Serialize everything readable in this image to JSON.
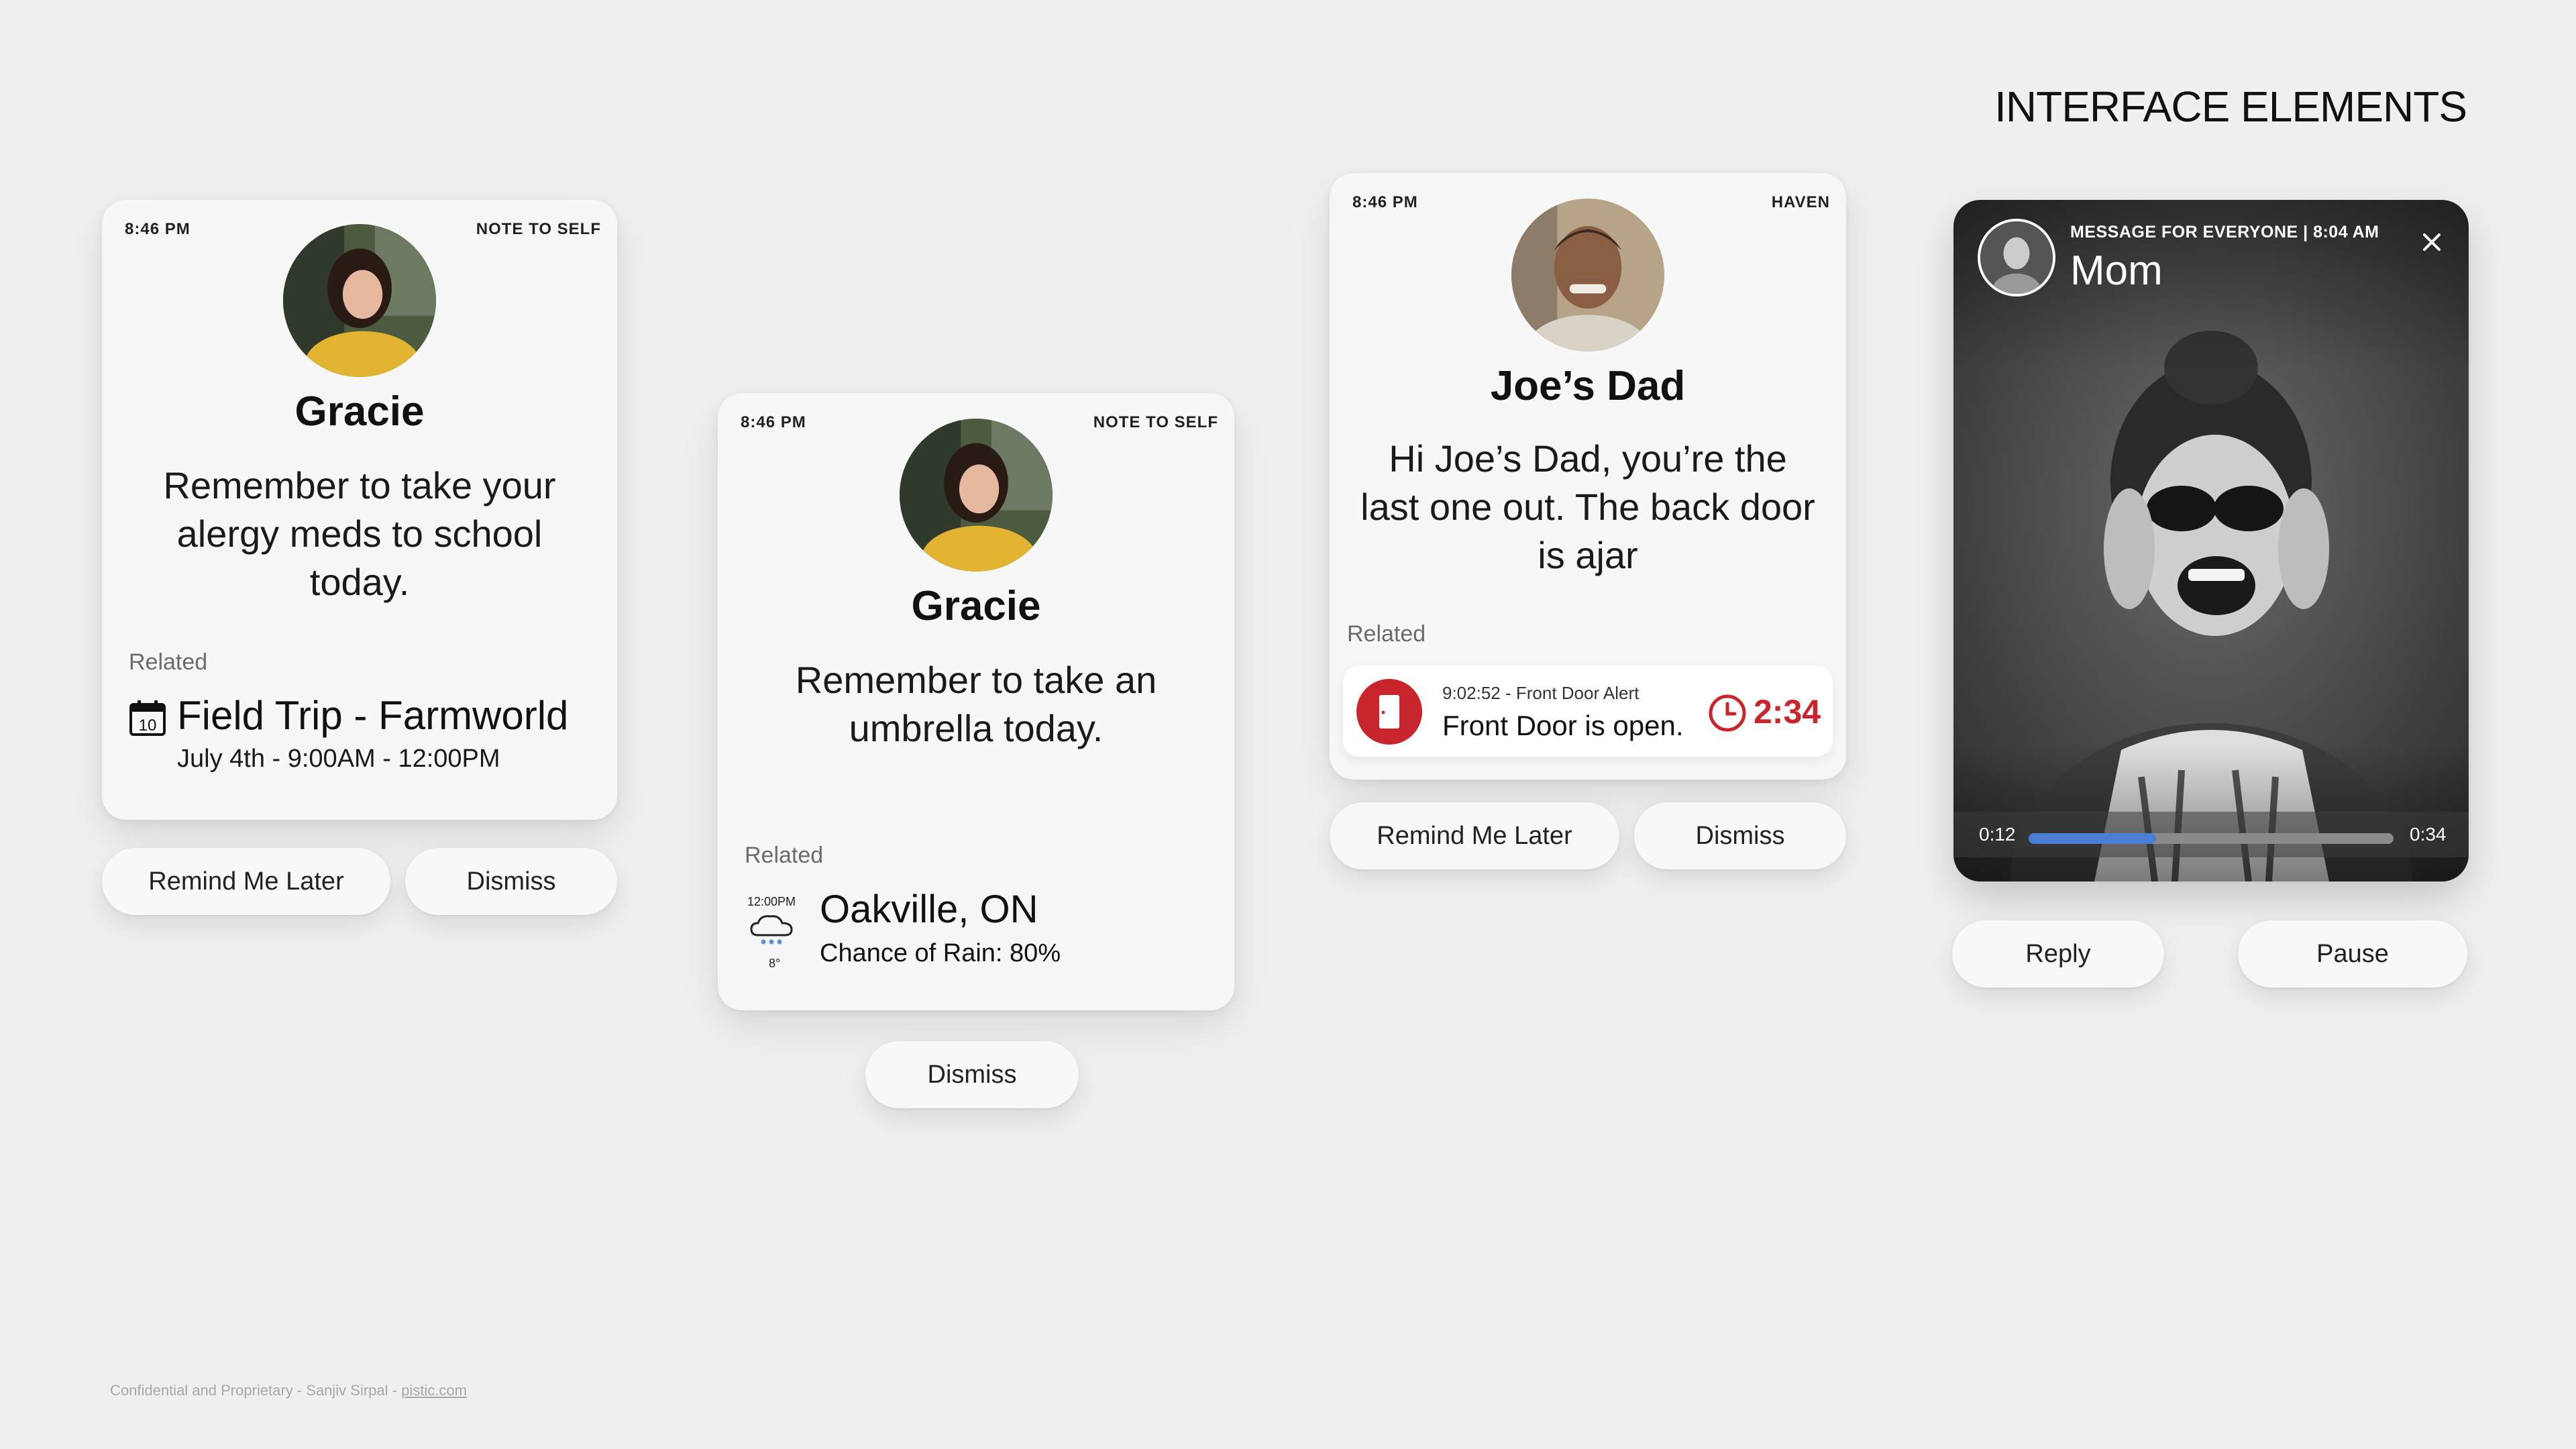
{
  "page": {
    "title": "INTERFACE ELEMENTS"
  },
  "card1": {
    "time": "8:46 PM",
    "label": "NOTE TO SELF",
    "name": "Gracie",
    "message": [
      "Remember to take your",
      "alergy meds to school",
      "today."
    ],
    "related_label": "Related",
    "event": {
      "title": "Field Trip - Farmworld",
      "time": "July 4th - 9:00AM - 12:00PM",
      "calendar_day": "10"
    },
    "buttons": {
      "remind": "Remind Me Later",
      "dismiss": "Dismiss"
    }
  },
  "card2": {
    "time": "8:46 PM",
    "label": "NOTE TO SELF",
    "name": "Gracie",
    "message": [
      "Remember to take an",
      "umbrella today."
    ],
    "related_label": "Related",
    "weather": {
      "time": "12:00PM",
      "temp": "8°",
      "city": "Oakville, ON",
      "desc": "Chance of Rain: 80%"
    },
    "buttons": {
      "dismiss": "Dismiss"
    }
  },
  "card3": {
    "time": "8:46 PM",
    "label": "HAVEN",
    "name": "Joe’s Dad",
    "message": [
      "Hi Joe’s Dad, you’re the",
      "last one out. The back door",
      "is ajar"
    ],
    "related_label": "Related",
    "alert": {
      "subtitle": "9:02:52 - Front Door Alert",
      "title": "Front Door is open.",
      "countdown": "2:34"
    },
    "buttons": {
      "remind": "Remind Me Later",
      "dismiss": "Dismiss"
    },
    "colors": {
      "alert_red": "#c8262c"
    }
  },
  "card4": {
    "header": "MESSAGE FOR EVERYONE | 8:04 AM",
    "sender": "Mom",
    "progress": {
      "current": "0:12",
      "total": "0:34",
      "fraction": 0.35
    },
    "buttons": {
      "reply": "Reply",
      "pause": "Pause"
    },
    "colors": {
      "progress": "#4a7fd6"
    }
  },
  "footer": {
    "text": "Confidential and Proprietary - Sanjiv Sirpal - ",
    "link": "pistic.com"
  }
}
